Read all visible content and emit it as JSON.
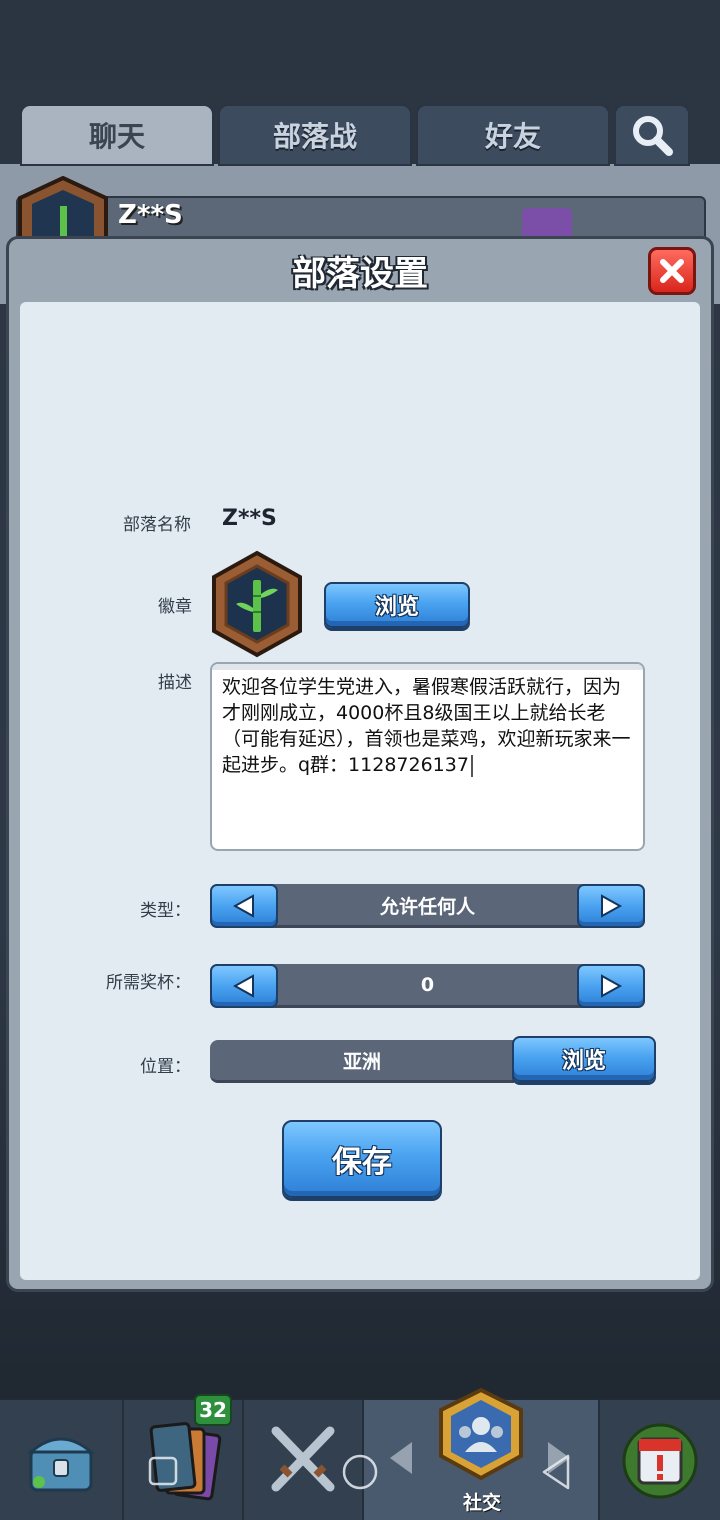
{
  "tabs": [
    {
      "label": "聊天",
      "active": true
    },
    {
      "label": "部落战",
      "active": false
    },
    {
      "label": "好友",
      "active": false
    }
  ],
  "header_clan_name": "Z**S",
  "modal": {
    "title": "部落设置",
    "fields": {
      "name_label": "部落名称",
      "name_value": "Z**S",
      "badge_label": "徽章",
      "browse_label": "浏览",
      "desc_label": "描述",
      "desc_value": "欢迎各位学生党进入，暑假寒假活跃就行，因为才刚刚成立，4000杯且8级国王以上就给长老（可能有延迟），首领也是菜鸡，欢迎新玩家来一起进步。q群：1128726137",
      "type_label": "类型：",
      "type_value": "允许任何人",
      "trophy_label": "所需奖杯：",
      "trophy_value": "0",
      "location_label": "位置：",
      "location_value": "亚洲",
      "location_browse_label": "浏览"
    },
    "save_label": "保存"
  },
  "bottom_nav": {
    "card_count": "32",
    "social_label": "社交"
  },
  "colors": {
    "accent_blue": "#4aa3f0",
    "close_red": "#e0332a",
    "modal_bg": "#e2ebf2"
  },
  "icons": [
    "search-icon",
    "close-icon",
    "bamboo-badge-icon",
    "arrow-left-icon",
    "arrow-right-icon",
    "chest-icon",
    "cards-icon",
    "battle-swords-icon",
    "social-icon",
    "events-icon"
  ]
}
